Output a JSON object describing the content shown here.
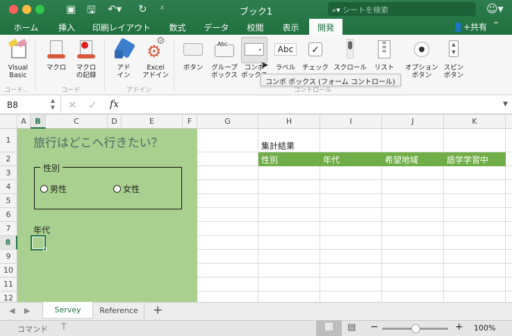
{
  "window": {
    "title": "ブック1",
    "search_placeholder": "シートを検索"
  },
  "tabs": [
    {
      "label": "ホーム"
    },
    {
      "label": "挿入"
    },
    {
      "label": "印刷レイアウト"
    },
    {
      "label": "数式"
    },
    {
      "label": "データ"
    },
    {
      "label": "校閲"
    },
    {
      "label": "表示"
    },
    {
      "label": "開発",
      "active": true
    }
  ],
  "share_label": "共有",
  "ribbon": {
    "items": [
      {
        "label": "Visual\nBasic",
        "icon": "visual-basic-icon"
      },
      {
        "label": "マクロ",
        "icon": "macro-icon"
      },
      {
        "label": "マクロ\nの記録",
        "icon": "record-macro-icon"
      },
      {
        "label": "アド\nイン",
        "icon": "add-in-icon"
      },
      {
        "label": "Excel\nアドイン",
        "icon": "excel-add-in-icon"
      },
      {
        "label": "ボタン",
        "icon": "button-control-icon"
      },
      {
        "label": "グループ\nボックス",
        "icon": "group-box-icon"
      },
      {
        "label": "コンボ\nボックス",
        "icon": "combo-box-icon"
      },
      {
        "label": "ラベル",
        "icon": "label-icon"
      },
      {
        "label": "チェック",
        "icon": "checkbox-icon"
      },
      {
        "label": "スクロール",
        "icon": "scrollbar-icon"
      },
      {
        "label": "リスト",
        "icon": "list-icon"
      },
      {
        "label": "オプション\nボタン",
        "icon": "option-button-icon"
      },
      {
        "label": "スピン\nボタン",
        "icon": "spin-button-icon"
      }
    ],
    "groups": [
      "コード...",
      "コード",
      "アドイン",
      "コントロール"
    ],
    "tooltip": "コンボ ボックス (フォーム コントロール)"
  },
  "formula_bar": {
    "name_box": "B8",
    "fx": "fx",
    "value": ""
  },
  "columns": [
    "A",
    "B",
    "C",
    "D",
    "E",
    "F",
    "G",
    "H",
    "I",
    "J",
    "K"
  ],
  "selected_column": "B",
  "rows": [
    "1",
    "2",
    "3",
    "4",
    "5",
    "6",
    "7",
    "8",
    "9",
    "10",
    "11",
    "12"
  ],
  "selected_row": "8",
  "form": {
    "title": "旅行はどこへ行きたい？",
    "group_label": "性別",
    "option_male": "男性",
    "option_female": "女性",
    "age_label": "年代",
    "background": "#a9d08e"
  },
  "summary": {
    "title": "集計結果",
    "headers": [
      "性別",
      "年代",
      "希望地域",
      "語学学習中"
    ],
    "header_color": "#70ad47"
  },
  "sheets": [
    {
      "name": "Servey",
      "active": true
    },
    {
      "name": "Reference"
    }
  ],
  "status": {
    "mode": "コマンド",
    "zoom": "100%",
    "zoom_level": 0.5
  }
}
